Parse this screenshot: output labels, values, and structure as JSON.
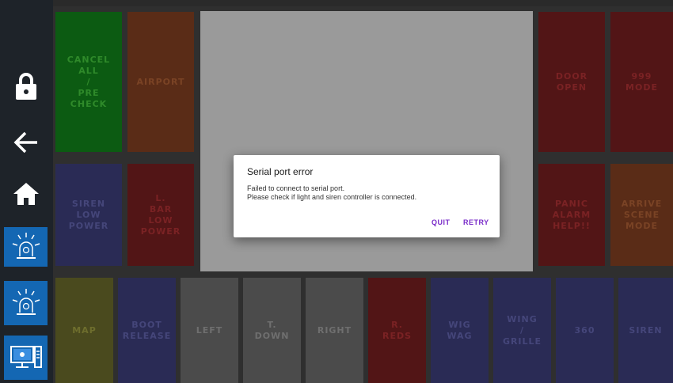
{
  "sidebar": {
    "items": [
      {
        "icon": "lock-icon"
      },
      {
        "icon": "arrow-left-icon"
      },
      {
        "icon": "home-icon"
      },
      {
        "icon": "siren-light-icon"
      },
      {
        "icon": "siren-light-icon"
      },
      {
        "icon": "computer-icon"
      }
    ],
    "accent": "#1467b3"
  },
  "tiles": {
    "top": [
      {
        "label": "CANCEL\nALL\n/\nPRE\nCHECK",
        "bg": "#0c5b12",
        "fg": "#2f8a2a"
      },
      {
        "label": "AIRPORT",
        "bg": "#5a2c17",
        "fg": "#7a4325"
      },
      {
        "label": "DOOR\nOPEN",
        "bg": "#521516",
        "fg": "#7a2224"
      },
      {
        "label": "999\nMODE",
        "bg": "#521516",
        "fg": "#7a2224"
      }
    ],
    "middle": [
      {
        "label": "SIREN\nLOW\nPOWER",
        "bg": "#2a2b55",
        "fg": "#45467a"
      },
      {
        "label": "L.\nBAR\nLOW\nPOWER",
        "bg": "#521516",
        "fg": "#7a2224"
      },
      {
        "label": "PANIC\nALARM\nHELP!!",
        "bg": "#521516",
        "fg": "#7a2224"
      },
      {
        "label": "ARRIVE\nSCENE\nMODE",
        "bg": "#5a2c17",
        "fg": "#7a4325"
      }
    ],
    "bottom": [
      {
        "label": "MAP",
        "bg": "#4a4a1e",
        "fg": "#6e6e2d"
      },
      {
        "label": "BOOT\nRELEASE",
        "bg": "#2a2b55",
        "fg": "#45467a"
      },
      {
        "label": "LEFT",
        "bg": "#4b4b4b",
        "fg": "#6f6f6f"
      },
      {
        "label": "T.\nDOWN",
        "bg": "#4b4b4b",
        "fg": "#6f6f6f"
      },
      {
        "label": "RIGHT",
        "bg": "#4b4b4b",
        "fg": "#6f6f6f"
      },
      {
        "label": "R.\nREDS",
        "bg": "#521516",
        "fg": "#7a2224"
      },
      {
        "label": "WIG\nWAG",
        "bg": "#2a2b55",
        "fg": "#45467a"
      },
      {
        "label": "WING\n/\nGRILLE",
        "bg": "#2a2b55",
        "fg": "#45467a"
      },
      {
        "label": "360",
        "bg": "#2a2b55",
        "fg": "#45467a"
      },
      {
        "label": "SIREN",
        "bg": "#2a2b55",
        "fg": "#45467a"
      }
    ]
  },
  "dialog": {
    "title": "Serial port error",
    "message_line1": "Failed to connect to serial port.",
    "message_line2": "Please check if light and siren controller is connected.",
    "quit_label": "QUIT",
    "retry_label": "RETRY",
    "button_color": "#7a2cc9"
  }
}
